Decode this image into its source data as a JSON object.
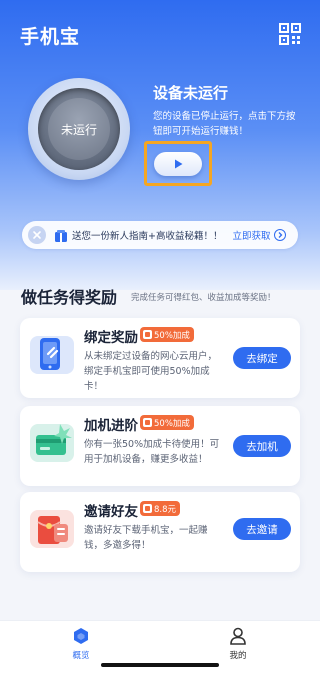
{
  "header": {
    "title": "手机宝",
    "qr_icon": "qr-code-icon"
  },
  "device": {
    "ring_label": "未运行",
    "status_title": "设备未运行",
    "status_desc": "您的设备已停止运行，点击下方按钮即可开始运行赚钱！",
    "play_icon": "play-icon"
  },
  "notice": {
    "text": "送您一份新人指南+高收益秘籍！！",
    "link_label": "立即获取",
    "icons": [
      "close-icon",
      "gift-icon",
      "chevron-right-icon"
    ]
  },
  "tasks": {
    "title": "做任务得奖励",
    "subtitle": "完成任务可得红包、收益加成等奖励！",
    "cards": [
      {
        "title": "绑定奖励",
        "badge": "50%加成",
        "desc": "从未绑定过设备的网心云用户，绑定手机宝即可使用50%加成卡！",
        "button": "去绑定",
        "icon": "phone-link-icon"
      },
      {
        "title": "加机进阶",
        "badge": "50%加成",
        "desc": "你有一张50%加成卡待使用！可用于加机设备，赚更多收益！",
        "button": "去加机",
        "icon": "bonus-card-icon"
      },
      {
        "title": "邀请好友",
        "badge": "8.8元",
        "desc": "邀请好友下载手机宝，一起赚钱，多邀多得！",
        "button": "去邀请",
        "icon": "red-packet-icon"
      }
    ]
  },
  "bottom_nav": {
    "items": [
      {
        "label": "概览",
        "icon": "overview-icon",
        "active": true
      },
      {
        "label": "我的",
        "icon": "user-icon",
        "active": false
      }
    ]
  },
  "colors": {
    "primary": "#2f6cf0",
    "badge": "#f26b3a",
    "highlight_frame": "#f5a623"
  }
}
